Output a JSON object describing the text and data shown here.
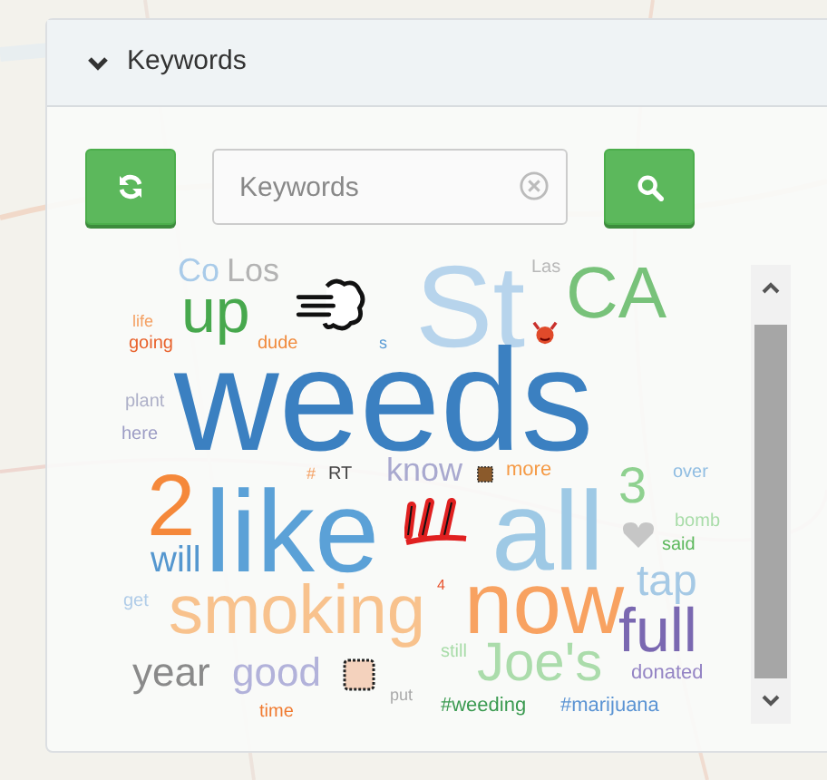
{
  "panel": {
    "title": "Keywords",
    "expanded": true
  },
  "search": {
    "placeholder": "Keywords"
  },
  "words": [
    {
      "text": "Co",
      "color": "#a9cbe9"
    },
    {
      "text": "Los",
      "color": "#b3b3b3"
    },
    {
      "text": "life",
      "color": "#f4a062"
    },
    {
      "text": "up",
      "color": "#47a84d"
    },
    {
      "text": "St",
      "color": "#b7d4ec"
    },
    {
      "text": "Las",
      "color": "#b8b8b8"
    },
    {
      "text": "CA",
      "color": "#78c27a"
    },
    {
      "text": "going",
      "color": "#e8622c"
    },
    {
      "text": "dude",
      "color": "#f08a3c"
    },
    {
      "text": "s",
      "color": "#5a9bd5"
    },
    {
      "text": "plant",
      "color": "#aeb0c8"
    },
    {
      "text": "here",
      "color": "#9c9cc4"
    },
    {
      "text": "weeds",
      "color": "#3b80c1"
    },
    {
      "text": "2",
      "color": "#f5883a"
    },
    {
      "text": "#",
      "color": "#f4a062"
    },
    {
      "text": "RT",
      "color": "#444444"
    },
    {
      "text": "know",
      "color": "#a9a9cf"
    },
    {
      "text": "more",
      "color": "#f59a45"
    },
    {
      "text": "3",
      "color": "#8fd190"
    },
    {
      "text": "over",
      "color": "#90bde2"
    },
    {
      "text": "will",
      "color": "#5597cf"
    },
    {
      "text": "like",
      "color": "#5ba1d7"
    },
    {
      "text": "all",
      "color": "#9ec9e5"
    },
    {
      "text": "bomb",
      "color": "#a8dca8"
    },
    {
      "text": "said",
      "color": "#5cb85c"
    },
    {
      "text": "get",
      "color": "#b0cce8"
    },
    {
      "text": "smoking",
      "color": "#f8c28d"
    },
    {
      "text": "4",
      "color": "#e8502a"
    },
    {
      "text": "now",
      "color": "#f8a261"
    },
    {
      "text": "tap",
      "color": "#a5c9e5"
    },
    {
      "text": "year",
      "color": "#8a8a8a"
    },
    {
      "text": "good",
      "color": "#b2b2da"
    },
    {
      "text": "still",
      "color": "#a8dca8"
    },
    {
      "text": "Joe's",
      "color": "#abdcab"
    },
    {
      "text": "full",
      "color": "#7a68b1"
    },
    {
      "text": "donated",
      "color": "#9484c4"
    },
    {
      "text": "time",
      "color": "#f07a30"
    },
    {
      "text": "put",
      "color": "#aaaaaa"
    },
    {
      "text": "#weeding",
      "color": "#3a9a50"
    },
    {
      "text": "#marijuana",
      "color": "#5a93d3"
    }
  ]
}
